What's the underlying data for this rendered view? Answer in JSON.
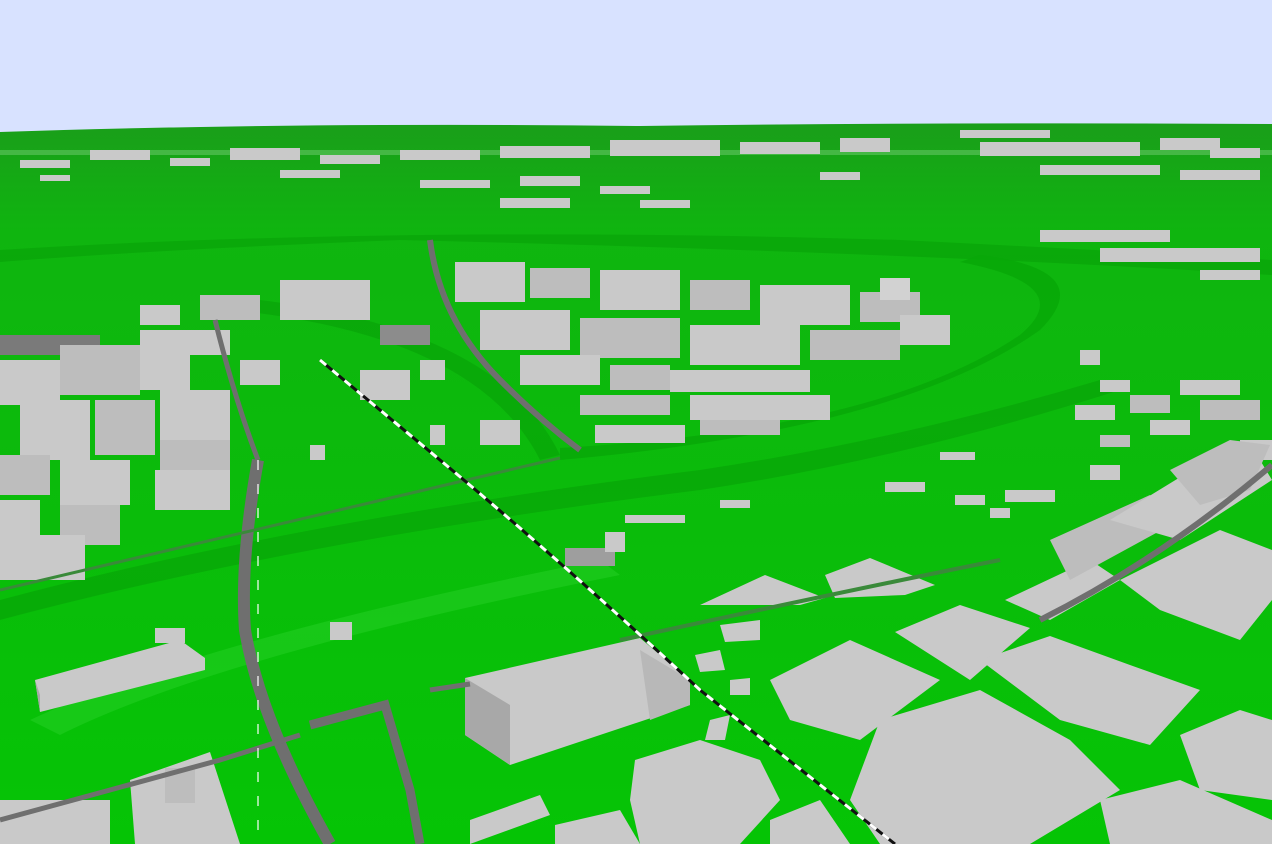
{
  "scene": {
    "kind": "3d-city-model",
    "colors": {
      "sky": "#d8e2ff",
      "terrain": "#0cbf0c",
      "terrain_dark": "#07a307",
      "terrain_light": "#22d022",
      "building_top": "#c9c9c9",
      "building_side": "#9e9e9e",
      "building_front": "#b4b4b4",
      "road": "#6f6f6f",
      "rail_white": "#ffffff",
      "rail_black": "#111111"
    }
  }
}
